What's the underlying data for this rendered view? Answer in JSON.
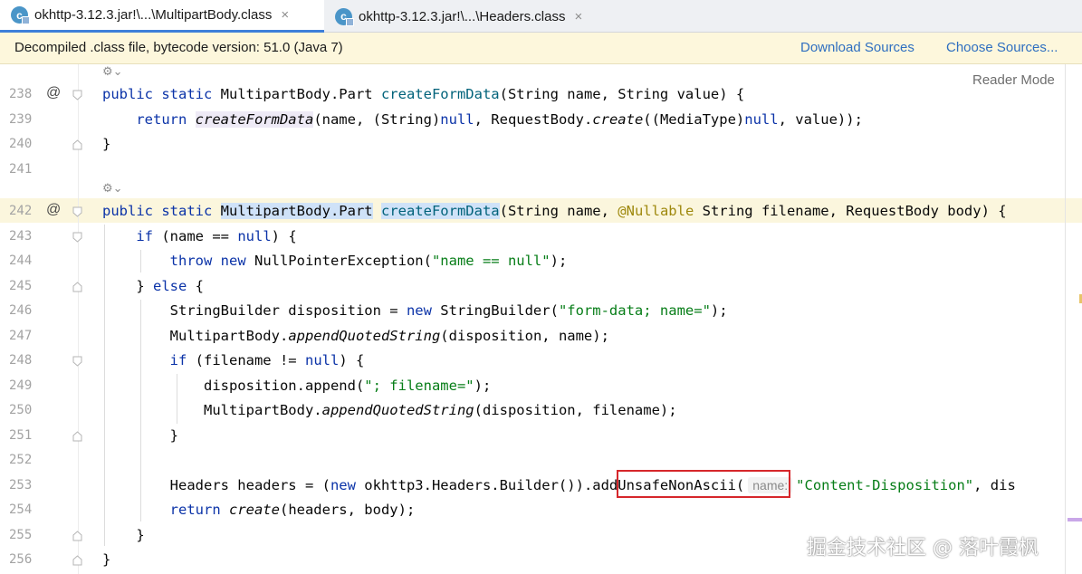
{
  "tabs": [
    {
      "icon": "c",
      "label": "okhttp-3.12.3.jar!\\...\\MultipartBody.class",
      "close": "×",
      "active": true
    },
    {
      "icon": "c",
      "label": "okhttp-3.12.3.jar!\\...\\Headers.class",
      "close": "×",
      "active": false
    }
  ],
  "banner": {
    "message": "Decompiled .class file, bytecode version: 51.0 (Java 7)",
    "download_sources": "Download Sources",
    "choose_sources": "Choose Sources..."
  },
  "editor": {
    "reader_mode": "Reader Mode",
    "override_marker": "@",
    "lens_icon": "⚙︎⌄",
    "line_numbers": [
      "238",
      "239",
      "240",
      "241",
      "242",
      "243",
      "244",
      "245",
      "246",
      "247",
      "248",
      "249",
      "250",
      "251",
      "252",
      "253",
      "254",
      "255",
      "256"
    ],
    "lines": {
      "l238": {
        "p1": "public static ",
        "type": "MultipartBody.Part ",
        "method": "createFormData",
        "rest": "(String name, String value) {"
      },
      "l239": {
        "indent": "    ",
        "kw": "return ",
        "call": "createFormData",
        "a": "(name, (String)",
        "null1": "null",
        "b": ", RequestBody.",
        "create": "create",
        "c": "((MediaType)",
        "null2": "null",
        "d": ", value));"
      },
      "l240": {
        "text": "}"
      },
      "l242": {
        "kw": "public static ",
        "type": "MultipartBody.Part",
        "sp": " ",
        "method": "createFormData",
        "a": "(String name, ",
        "ann": "@Nullable",
        "b": " String filename, RequestBody body) {"
      },
      "l243": {
        "indent": "    ",
        "kw": "if ",
        "a": "(name == ",
        "null": "null",
        "b": ") {"
      },
      "l244": {
        "indent": "        ",
        "kw1": "throw ",
        "kw2": "new ",
        "a": "NullPointerException(",
        "str": "\"name == null\"",
        "b": ");"
      },
      "l245": {
        "indent": "    ",
        "a": "} ",
        "kw": "else ",
        "b": "{"
      },
      "l246": {
        "indent": "        ",
        "a": "StringBuilder disposition = ",
        "kw": "new ",
        "b": "StringBuilder(",
        "str": "\"form-data; name=\"",
        "c": ");"
      },
      "l247": {
        "indent": "        ",
        "a": "MultipartBody.",
        "call": "appendQuotedString",
        "b": "(disposition, name);"
      },
      "l248": {
        "indent": "        ",
        "kw": "if ",
        "a": "(filename != ",
        "null": "null",
        "b": ") {"
      },
      "l249": {
        "indent": "            ",
        "a": "disposition.append(",
        "str": "\"; filename=\"",
        "b": ");"
      },
      "l250": {
        "indent": "            ",
        "a": "MultipartBody.",
        "call": "appendQuotedString",
        "b": "(disposition, filename);"
      },
      "l251": {
        "indent": "        ",
        "text": "}"
      },
      "l253": {
        "indent": "        ",
        "a": "Headers headers = (",
        "kw": "new ",
        "b": "okhttp3.Headers.Builder())",
        "c": ".addUnsafeNonAscii(",
        "hint": "name:",
        "str": "\"Content-Disposition\"",
        "d": ", dis"
      },
      "l254": {
        "indent": "        ",
        "kw": "return ",
        "call": "create",
        "b": "(headers, body);"
      },
      "l255": {
        "indent": "    ",
        "text": "}"
      },
      "l256": {
        "text": "}"
      }
    }
  },
  "watermark": "掘金技术社区 @ 落叶霞枫",
  "colors": {
    "keyword": "#0b33a8",
    "method": "#00627a",
    "string": "#067d17",
    "annotation": "#9e880d",
    "highlight_box": "#d6272b",
    "banner_bg": "#fdf7dc",
    "link": "#2f6fc0"
  }
}
